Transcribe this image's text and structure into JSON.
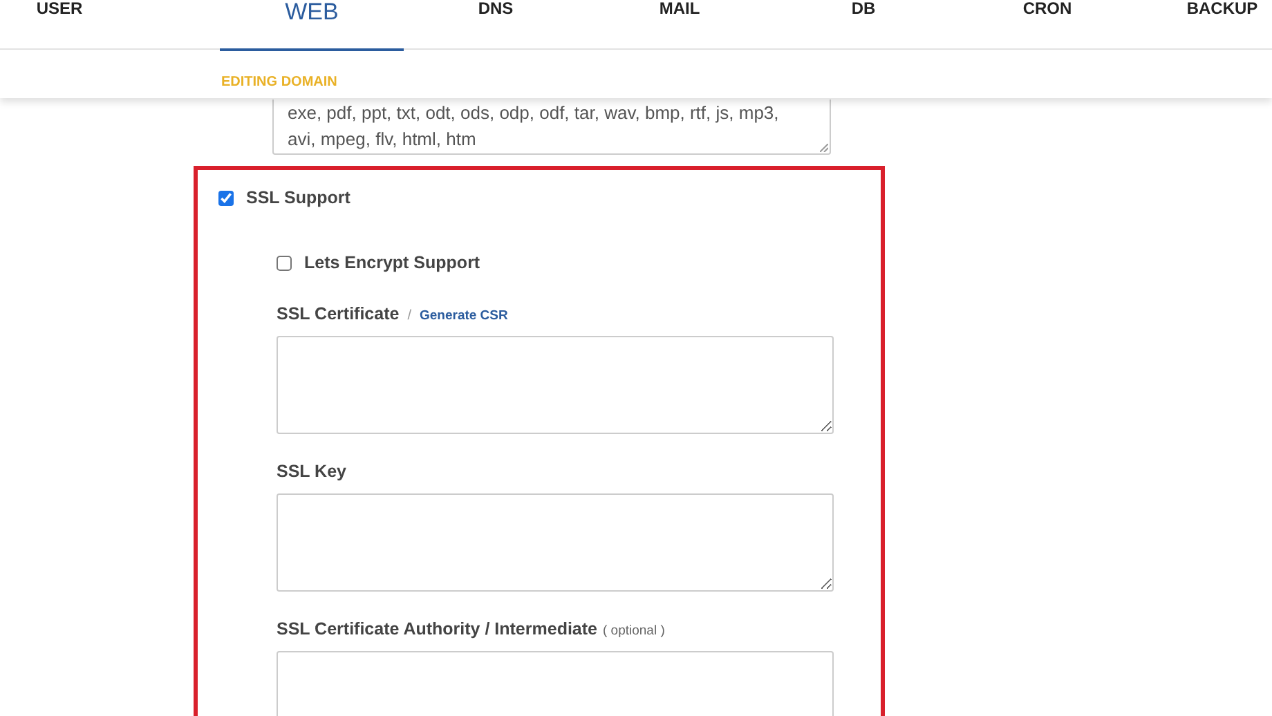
{
  "tabs": [
    {
      "label": "USER",
      "selected": false
    },
    {
      "label": "WEB",
      "selected": true
    },
    {
      "label": "DNS",
      "selected": false
    },
    {
      "label": "MAIL",
      "selected": false
    },
    {
      "label": "DB",
      "selected": false
    },
    {
      "label": "CRON",
      "selected": false
    },
    {
      "label": "BACKUP",
      "selected": false
    }
  ],
  "subtitle": "EDITING DOMAIN",
  "extensions": {
    "value": [
      "exe, pdf, ppt, txt, odt, ods, odp, odf, tar, wav, bmp, rtf, js, mp3,",
      "avi, mpeg, flv, html, htm"
    ]
  },
  "ssl_support": {
    "label": "SSL Support",
    "checked": true
  },
  "lets_encrypt": {
    "label": "Lets Encrypt Support",
    "checked": false
  },
  "fields": [
    {
      "label": "SSL Certificate",
      "separator": "/",
      "link": "Generate CSR"
    },
    {
      "label": "SSL Key"
    },
    {
      "label": "SSL Certificate Authority / Intermediate",
      "note": "( optional )"
    }
  ]
}
